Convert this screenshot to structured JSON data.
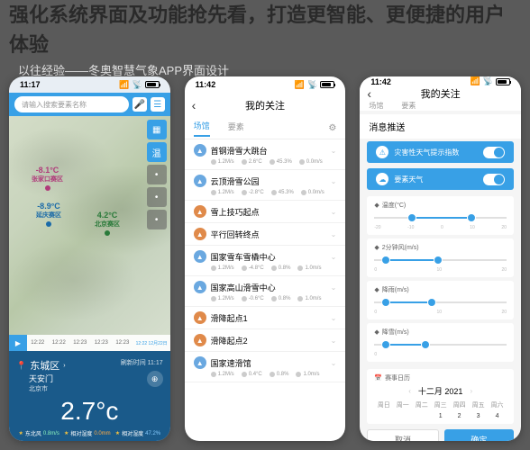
{
  "bg_title": "强化系统界面及功能抢先看，打造更智能、更便捷的用户体验",
  "caption": "以往经验——冬奥智慧气象APP界面设计",
  "statusbar": {
    "time1": "11:17",
    "time2": "11:42",
    "time3": "11:42"
  },
  "phone1": {
    "search_placeholder": "请输入搜索要素名称",
    "map_points": [
      {
        "temp": "-8.1°C",
        "name": "张家口赛区"
      },
      {
        "temp": "-8.9°C",
        "name": "延庆赛区"
      },
      {
        "temp": "4.2°C",
        "name": "北京赛区"
      }
    ],
    "timeline": {
      "times": [
        "12:22",
        "12:22",
        "12:23",
        "12:23",
        "12:23"
      ],
      "stamp": "12:22 12月22日"
    },
    "location": {
      "district": "东城区",
      "spot": "天安门",
      "city": "北京市"
    },
    "big_temp": "2.7°c",
    "details": [
      {
        "label": "东北风",
        "val": "0.8m/s"
      },
      {
        "label": "相对湿度",
        "val": "0.0mm"
      },
      {
        "label": "相对湿度",
        "val": "47.2%"
      }
    ],
    "refresh": "刷新时间 11:17"
  },
  "phone2": {
    "title": "我的关注",
    "tabs": [
      "场馆",
      "要素"
    ],
    "items": [
      {
        "icon_bg": "#6aa8e0",
        "name": "首钢滑雪大跳台",
        "stats": [
          "1.2M/s",
          "2.6°C",
          "45.3%",
          "0.0m/s"
        ]
      },
      {
        "icon_bg": "#6aa8e0",
        "name": "云顶滑雪公园",
        "stats": [
          "1.2M/s",
          "-2.8°C",
          "45.3%",
          "0.0m/s"
        ]
      },
      {
        "icon_bg": "#e08a4a",
        "name": "雪上技巧起点",
        "stats": []
      },
      {
        "icon_bg": "#e08a4a",
        "name": "平行回转终点",
        "stats": []
      },
      {
        "icon_bg": "#6aa8e0",
        "name": "国家雪车雪橇中心",
        "stats": [
          "1.2M/s",
          "-4.8°C",
          "0.8%",
          "1.0m/s"
        ]
      },
      {
        "icon_bg": "#6aa8e0",
        "name": "国家高山滑雪中心",
        "stats": [
          "1.2M/s",
          "-0.6°C",
          "0.8%",
          "1.0m/s"
        ]
      },
      {
        "icon_bg": "#e08a4a",
        "name": "滑降起点1",
        "stats": []
      },
      {
        "icon_bg": "#e08a4a",
        "name": "滑降起点2",
        "stats": []
      },
      {
        "icon_bg": "#6aa8e0",
        "name": "国家速滑馆",
        "stats": [
          "1.2M/s",
          "0.4°C",
          "0.8%",
          "1.0m/s"
        ]
      }
    ]
  },
  "phone3": {
    "title": "我的关注",
    "tabs": [
      "场馆",
      "要素"
    ],
    "panel_title": "消息推送",
    "toggles": [
      {
        "label": "灾害性天气提示指数"
      },
      {
        "label": "要素天气"
      }
    ],
    "sliders": [
      {
        "label": "温度(°C)",
        "scale": [
          "-20",
          "-10",
          "0",
          "10",
          "20"
        ],
        "low": 25,
        "high": 70
      },
      {
        "label": "2分钟风(m/s)",
        "scale": [
          "0",
          "",
          "10",
          "",
          "20"
        ],
        "low": 5,
        "high": 45
      },
      {
        "label": "降雨(m/s)",
        "scale": [
          "0",
          "",
          "10",
          "",
          "20"
        ],
        "low": 5,
        "high": 40
      },
      {
        "label": "降雪(m/s)",
        "scale": [
          "0",
          "",
          "",
          "",
          ""
        ],
        "low": 5,
        "high": 35
      }
    ],
    "calendar": {
      "label": "赛事日历",
      "month": "十二月 2021",
      "weekdays": [
        "周日",
        "周一",
        "周二",
        "周三",
        "周四",
        "周五",
        "周六"
      ],
      "days": [
        "",
        "",
        "",
        "1",
        "2",
        "3",
        "4"
      ]
    },
    "buttons": {
      "cancel": "取消",
      "ok": "确定"
    }
  }
}
